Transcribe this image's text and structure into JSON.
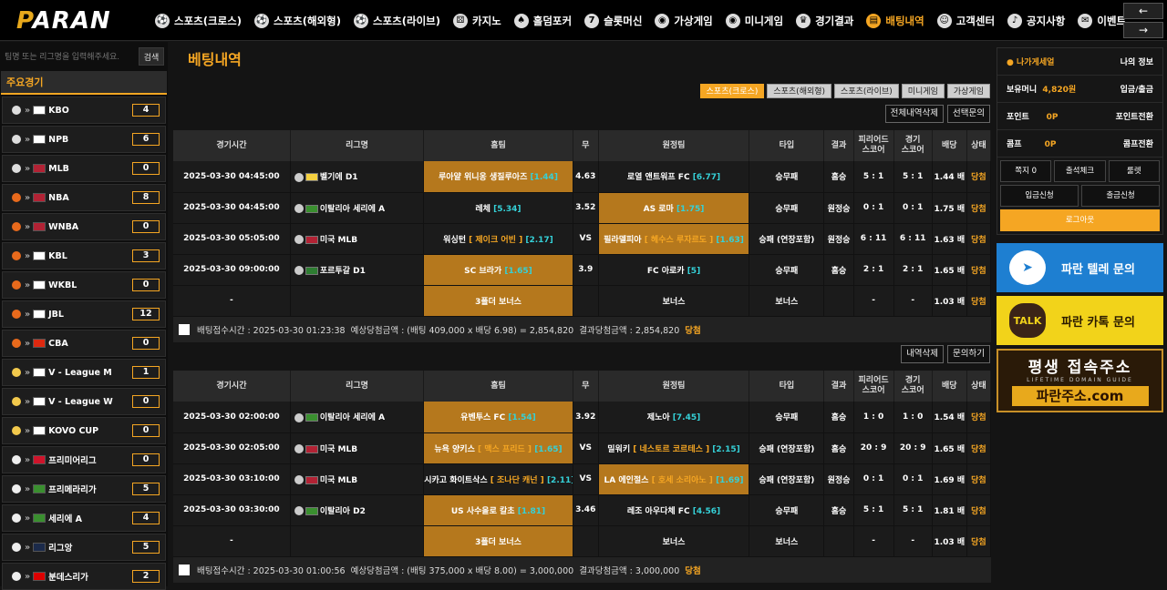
{
  "header": {
    "logo_a": "P",
    "logo_b": "ARAN",
    "nav": [
      {
        "label": "스포츠(크로스)",
        "icon": "⚽"
      },
      {
        "label": "스포츠(해외형)",
        "icon": "⚽"
      },
      {
        "label": "스포츠(라이브)",
        "icon": "⚽"
      },
      {
        "label": "카지노",
        "icon": "⚄"
      },
      {
        "label": "홀덤포커",
        "icon": "♠"
      },
      {
        "label": "슬롯머신",
        "icon": "7"
      },
      {
        "label": "가상게임",
        "icon": "◉"
      },
      {
        "label": "미니게임",
        "icon": "◉"
      },
      {
        "label": "경기결과",
        "icon": "♛"
      },
      {
        "label": "배팅내역",
        "icon": "▤"
      },
      {
        "label": "고객센터",
        "icon": "☺"
      },
      {
        "label": "공지사항",
        "icon": "♪"
      },
      {
        "label": "이벤트",
        "icon": "✉"
      }
    ],
    "arrow_left": "←",
    "arrow_right": "→"
  },
  "left": {
    "search_placeholder": "팀명 또는 리그명을 입력해주세요.",
    "search_button": "검색",
    "section_title": "주요경기",
    "leagues": [
      {
        "name": "KBO",
        "count": "4",
        "sport": "#ddd",
        "flag": "#fff"
      },
      {
        "name": "NPB",
        "count": "6",
        "sport": "#ddd",
        "flag": "#fff"
      },
      {
        "name": "MLB",
        "count": "0",
        "sport": "#ddd",
        "flag": "#b22234"
      },
      {
        "name": "NBA",
        "count": "8",
        "sport": "#e86a1c",
        "flag": "#b22234"
      },
      {
        "name": "WNBA",
        "count": "0",
        "sport": "#e86a1c",
        "flag": "#b22234"
      },
      {
        "name": "KBL",
        "count": "3",
        "sport": "#e86a1c",
        "flag": "#fff"
      },
      {
        "name": "WKBL",
        "count": "0",
        "sport": "#e86a1c",
        "flag": "#fff"
      },
      {
        "name": "JBL",
        "count": "12",
        "sport": "#e86a1c",
        "flag": "#fff"
      },
      {
        "name": "CBA",
        "count": "0",
        "sport": "#e86a1c",
        "flag": "#de2910"
      },
      {
        "name": "V - League M",
        "count": "1",
        "sport": "#f2c94c",
        "flag": "#fff"
      },
      {
        "name": "V - League W",
        "count": "0",
        "sport": "#f2c94c",
        "flag": "#fff"
      },
      {
        "name": "KOVO CUP",
        "count": "0",
        "sport": "#f2c94c",
        "flag": "#fff"
      },
      {
        "name": "프리미어리그",
        "count": "0",
        "sport": "#eee",
        "flag": "#cf142b"
      },
      {
        "name": "프리메라리가",
        "count": "5",
        "sport": "#eee",
        "flag": "#3a8f2f"
      },
      {
        "name": "세리에 A",
        "count": "4",
        "sport": "#eee",
        "flag": "#3a8f2f"
      },
      {
        "name": "리그앙",
        "count": "5",
        "sport": "#eee",
        "flag": "#1b2a4a"
      },
      {
        "name": "분데스리가",
        "count": "2",
        "sport": "#eee",
        "flag": "#d00"
      }
    ]
  },
  "main": {
    "title": "베팅내역",
    "filters": [
      "스포츠(크로스)",
      "스포츠(해외형)",
      "스포츠(라이브)",
      "미니게임",
      "가상게임"
    ],
    "actions_top": [
      "전체내역삭제",
      "선택문의"
    ],
    "actions_mid": [
      "내역삭제",
      "문의하기"
    ],
    "columns": [
      "경기시간",
      "리그명",
      "홈팀",
      "무",
      "원정팀",
      "타입",
      "결과",
      "피리어드\n스코어",
      "경기\n스코어",
      "배당",
      "상태"
    ],
    "slip1": {
      "rows": [
        {
          "time": "2025-03-30 04:45:00",
          "sport": "⚽",
          "flag": "#f4d03f",
          "league": "벨기에 D1",
          "home": "루아얄 위니옹 생질루아즈",
          "home_odd": "[1.44]",
          "draw": "4.63",
          "away": "로열 앤트워프 FC",
          "away_odd": "[6.77]",
          "type": "승무패",
          "result": "홈승",
          "pscore": "5 : 1",
          "gscore": "5 : 1",
          "odds": "1.44 배",
          "status": "당첨",
          "pick": "home"
        },
        {
          "time": "2025-03-30 04:45:00",
          "sport": "⚽",
          "flag": "#3a8f2f",
          "league": "이탈리아 세리에 A",
          "home": "레체",
          "home_odd": "[5.34]",
          "draw": "3.52",
          "away": "AS 로마",
          "away_odd": "[1.75]",
          "type": "승무패",
          "result": "원정승",
          "pscore": "0 : 1",
          "gscore": "0 : 1",
          "odds": "1.75 배",
          "status": "당첨",
          "pick": "away"
        },
        {
          "time": "2025-03-30 05:05:00",
          "sport": "⚾",
          "flag": "#b22234",
          "league": "미국 MLB",
          "home": "워싱턴",
          "home_pitcher": "[ 제이크 어빈 ]",
          "home_odd": "[2.17]",
          "draw": "VS",
          "away": "필라델피아",
          "away_pitcher": "[ 헤수스 루자르도 ]",
          "away_odd": "[1.63]",
          "type": "승패 (연장포함)",
          "result": "원정승",
          "pscore": "6 : 11",
          "gscore": "6 : 11",
          "odds": "1.63 배",
          "status": "당첨",
          "pick": "away"
        },
        {
          "time": "2025-03-30 09:00:00",
          "sport": "⚽",
          "flag": "#2e7d32",
          "league": "포르투갈 D1",
          "home": "SC 브라가",
          "home_odd": "[1.65]",
          "draw": "3.9",
          "away": "FC 아로카",
          "away_odd": "[5]",
          "type": "승무패",
          "result": "홈승",
          "pscore": "2 : 1",
          "gscore": "2 : 1",
          "odds": "1.65 배",
          "status": "당첨",
          "pick": "home"
        },
        {
          "time": "-",
          "sport": "",
          "flag": "",
          "league": "",
          "home": "3폴더 보너스",
          "home_odd": "",
          "draw": "",
          "away": "보너스",
          "away_odd": "",
          "type": "보너스",
          "result": "",
          "pscore": "-",
          "gscore": "-",
          "odds": "1.03 배",
          "status": "당첨",
          "pick": "home"
        }
      ],
      "summary_time": "배팅접수시간 : 2025-03-30 01:23:38",
      "summary_expected": "예상당첨금액 : (배팅 409,000 x 배당 6.98) = 2,854,820",
      "summary_result": "결과당첨금액 : 2,854,820",
      "summary_status": "당첨"
    },
    "slip2": {
      "rows": [
        {
          "time": "2025-03-30 02:00:00",
          "sport": "⚽",
          "flag": "#3a8f2f",
          "league": "이탈리아 세리에 A",
          "home": "유벤투스 FC",
          "home_odd": "[1.54]",
          "draw": "3.92",
          "away": "제노아",
          "away_odd": "[7.45]",
          "type": "승무패",
          "result": "홈승",
          "pscore": "1 : 0",
          "gscore": "1 : 0",
          "odds": "1.54 배",
          "status": "당첨",
          "pick": "home"
        },
        {
          "time": "2025-03-30 02:05:00",
          "sport": "⚾",
          "flag": "#b22234",
          "league": "미국 MLB",
          "home": "뉴욕 양키스",
          "home_pitcher": "[ 맥스 프리드 ]",
          "home_odd": "[1.65]",
          "draw": "VS",
          "away": "밀워키",
          "away_pitcher": "[ 네스토르 코르테스 ]",
          "away_odd": "[2.15]",
          "type": "승패 (연장포함)",
          "result": "홈승",
          "pscore": "20 : 9",
          "gscore": "20 : 9",
          "odds": "1.65 배",
          "status": "당첨",
          "pick": "home"
        },
        {
          "time": "2025-03-30 03:10:00",
          "sport": "⚾",
          "flag": "#b22234",
          "league": "미국 MLB",
          "home": "시카고 화이트삭스",
          "home_pitcher": "[ 조나단 캐넌 ]",
          "home_odd": "[2.11]",
          "draw": "VS",
          "away": "LA 에인절스",
          "away_pitcher": "[ 호세 소리아노 ]",
          "away_odd": "[1.69]",
          "type": "승패 (연장포함)",
          "result": "원정승",
          "pscore": "0 : 1",
          "gscore": "0 : 1",
          "odds": "1.69 배",
          "status": "당첨",
          "pick": "away"
        },
        {
          "time": "2025-03-30 03:30:00",
          "sport": "⚽",
          "flag": "#3a8f2f",
          "league": "이탈리아 D2",
          "home": "US 사수올로 칼초",
          "home_odd": "[1.81]",
          "draw": "3.46",
          "away": "레조 아우다체 FC",
          "away_odd": "[4.56]",
          "type": "승무패",
          "result": "홈승",
          "pscore": "5 : 1",
          "gscore": "5 : 1",
          "odds": "1.81 배",
          "status": "당첨",
          "pick": "home"
        },
        {
          "time": "-",
          "sport": "",
          "flag": "",
          "league": "",
          "home": "3폴더 보너스",
          "home_odd": "",
          "draw": "",
          "away": "보너스",
          "away_odd": "",
          "type": "보너스",
          "result": "",
          "pscore": "-",
          "gscore": "-",
          "odds": "1.03 배",
          "status": "당첨",
          "pick": "home"
        }
      ],
      "summary_time": "배팅접수시간 : 2025-03-30 01:00:56",
      "summary_expected": "예상당첨금액 : (배팅 375,000 x 배당 8.00) = 3,000,000",
      "summary_result": "결과당첨금액 : 3,000,000",
      "summary_status": "당첨"
    }
  },
  "right": {
    "user_level": "나가게세얼",
    "my_info": "나의 정보",
    "balance_label": "보유머니",
    "balance_value": "4,820원",
    "deposit_withdraw": "입금/출금",
    "point_label": "포인트",
    "point_value": "0P",
    "point_convert": "포인트전환",
    "comp_label": "콤프",
    "comp_value": "0P",
    "comp_convert": "콤프전환",
    "buttons3": [
      "쪽지 0",
      "출석체크",
      "룰렛"
    ],
    "buttons2": [
      "입금신청",
      "출금신청"
    ],
    "logout": "로그아웃",
    "telegram": "파란 텔레 문의",
    "kakao": "파란 카톡 문의",
    "kakao_icon": "TALK",
    "domain_main": "평생 접속주소",
    "domain_sub": "LIFETIME DOMAIN GUIDE",
    "domain_url": "파란주소.com"
  }
}
